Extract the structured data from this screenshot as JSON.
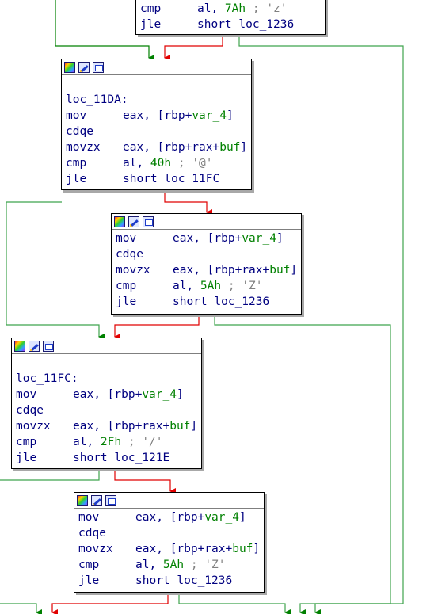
{
  "top_block": {
    "lines": [
      {
        "mnemonic": "cmp",
        "op1": "al, ",
        "num": "7Ah",
        "sep": " ; ",
        "comment": "'z'"
      },
      {
        "mnemonic": "jle",
        "text": "short loc_1236"
      }
    ]
  },
  "block_11DA": {
    "label": "loc_11DA:",
    "lines": [
      {
        "mnemonic": "mov",
        "pre": "eax, [rbp+",
        "var": "var_4",
        "post": "]"
      },
      {
        "mnemonic": "cdqe"
      },
      {
        "mnemonic": "movzx",
        "pre": "eax, [rbp+rax+",
        "var": "buf",
        "post": "]"
      },
      {
        "mnemonic": "cmp",
        "op1": "al, ",
        "num": "40h",
        "sep": " ; ",
        "comment": "'@'"
      },
      {
        "mnemonic": "jle",
        "text": "short loc_11FC"
      }
    ]
  },
  "block_5Ah_a": {
    "lines": [
      {
        "mnemonic": "mov",
        "pre": "eax, [rbp+",
        "var": "var_4",
        "post": "]"
      },
      {
        "mnemonic": "cdqe"
      },
      {
        "mnemonic": "movzx",
        "pre": "eax, [rbp+rax+",
        "var": "buf",
        "post": "]"
      },
      {
        "mnemonic": "cmp",
        "op1": "al, ",
        "num": "5Ah",
        "sep": " ; ",
        "comment": "'Z'"
      },
      {
        "mnemonic": "jle",
        "text": "short loc_1236"
      }
    ]
  },
  "block_11FC": {
    "label": "loc_11FC:",
    "lines": [
      {
        "mnemonic": "mov",
        "pre": "eax, [rbp+",
        "var": "var_4",
        "post": "]"
      },
      {
        "mnemonic": "cdqe"
      },
      {
        "mnemonic": "movzx",
        "pre": "eax, [rbp+rax+",
        "var": "buf",
        "post": "]"
      },
      {
        "mnemonic": "cmp",
        "op1": "al, ",
        "num": "2Fh",
        "sep": " ; ",
        "comment": "'/'"
      },
      {
        "mnemonic": "jle",
        "text": "short loc_121E"
      }
    ]
  },
  "block_5Ah_b": {
    "lines": [
      {
        "mnemonic": "mov",
        "pre": "eax, [rbp+",
        "var": "var_4",
        "post": "]"
      },
      {
        "mnemonic": "cdqe"
      },
      {
        "mnemonic": "movzx",
        "pre": "eax, [rbp+rax+",
        "var": "buf",
        "post": "]"
      },
      {
        "mnemonic": "cmp",
        "op1": "al, ",
        "num": "5Ah",
        "sep": " ; ",
        "comment": "'Z'"
      },
      {
        "mnemonic": "jle",
        "text": "short loc_1236"
      }
    ]
  },
  "node_header_icons": [
    "node-color-icon",
    "edit-node-icon",
    "graph-overview-icon"
  ],
  "colors": {
    "true_edge": "#008000",
    "false_edge": "#e00000",
    "jump_edge": "#3fa34d",
    "mnemonic": "#000080",
    "comment": "#808080",
    "number": "#008000"
  }
}
